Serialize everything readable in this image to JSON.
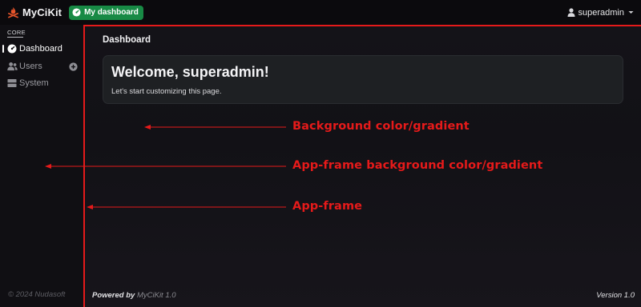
{
  "navbar": {
    "brand_name": "MyCiKit",
    "dashboard_button": "My dashboard",
    "user_name": "superadmin"
  },
  "sidebar": {
    "section_heading": "CORE",
    "items": [
      {
        "label": "Dashboard",
        "icon": "gauge-icon",
        "active": true
      },
      {
        "label": "Users",
        "icon": "users-icon",
        "active": false
      },
      {
        "label": "System",
        "icon": "server-icon",
        "active": false
      }
    ],
    "footer": "© 2024 Nudasoft"
  },
  "main": {
    "page_title": "Dashboard",
    "welcome_title": "Welcome, superadmin!",
    "welcome_text": "Let's start customizing this page."
  },
  "footer": {
    "powered_by_label": "Powered by",
    "powered_by_product": "MyCiKit 1.0",
    "version": "Version 1.0"
  },
  "annotations": {
    "background": "Background color/gradient",
    "app_frame_background": "App-frame background color/gradient",
    "app_frame": "App-frame",
    "color": "#e51a1a"
  },
  "colors": {
    "accent_green": "#188a45",
    "annotation_red": "#e51a1a"
  }
}
